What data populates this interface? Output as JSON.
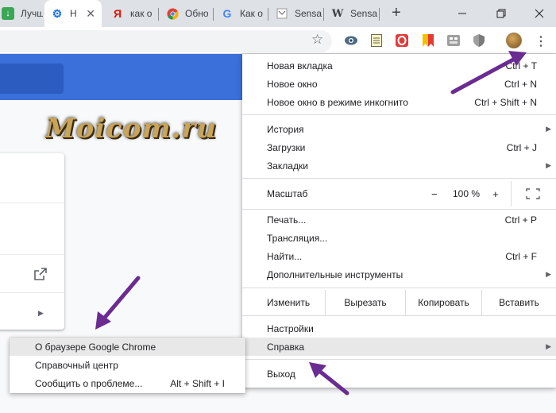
{
  "tabs": [
    {
      "title": "Лучш",
      "favicon": "download-icon",
      "active": false
    },
    {
      "title": "Н",
      "favicon": "settings-gear-icon",
      "active": true
    },
    {
      "title": "как о",
      "favicon": "yandex-icon",
      "active": false
    },
    {
      "title": "Обно",
      "favicon": "chrome-icon",
      "active": false
    },
    {
      "title": "Как о",
      "favicon": "google-icon",
      "active": false
    },
    {
      "title": "Sensa",
      "favicon": "page-icon",
      "active": false
    },
    {
      "title": "Sensa",
      "favicon": "wikipedia-icon",
      "active": false
    }
  ],
  "window_controls": [
    "minimize-icon",
    "restore-icon",
    "close-icon"
  ],
  "toolbar": {
    "extensions": [
      "eye-extension-icon",
      "notes-extension-icon",
      "opera-extension-icon",
      "bookmark-extension-icon",
      "puzzle-extension-icon",
      "shield-extension-icon"
    ]
  },
  "watermark": "Moicom.ru",
  "menu": {
    "items": [
      {
        "label": "Новая вкладка",
        "shortcut": "Ctrl + T"
      },
      {
        "label": "Новое окно",
        "shortcut": "Ctrl + N"
      },
      {
        "label": "Новое окно в режиме инкогнито",
        "shortcut": "Ctrl + Shift + N"
      },
      {
        "label": "История",
        "shortcut": ""
      },
      {
        "label": "Загрузки",
        "shortcut": "Ctrl + J"
      },
      {
        "label": "Закладки",
        "shortcut": ""
      },
      {
        "label": "Печать...",
        "shortcut": "Ctrl + P"
      },
      {
        "label": "Трансляция...",
        "shortcut": ""
      },
      {
        "label": "Найти...",
        "shortcut": "Ctrl + F"
      },
      {
        "label": "Дополнительные инструменты",
        "shortcut": ""
      },
      {
        "label": "Настройки",
        "shortcut": ""
      },
      {
        "label": "Справка",
        "shortcut": ""
      },
      {
        "label": "Выход",
        "shortcut": ""
      }
    ],
    "zoom": {
      "label": "Масштаб",
      "minus": "−",
      "value": "100 %",
      "plus": "+"
    },
    "edit": {
      "label": "Изменить",
      "cut": "Вырезать",
      "copy": "Копировать",
      "paste": "Вставить"
    }
  },
  "submenu": {
    "items": [
      {
        "label": "О браузере Google Chrome",
        "shortcut": ""
      },
      {
        "label": "Справочный центр",
        "shortcut": ""
      },
      {
        "label": "Сообщить о проблеме...",
        "shortcut": "Alt + Shift + I"
      }
    ]
  },
  "colors": {
    "accent_blue": "#3b6fd9",
    "annotation_arrow": "#6a2c91",
    "highlight": "#e8e8e8"
  }
}
